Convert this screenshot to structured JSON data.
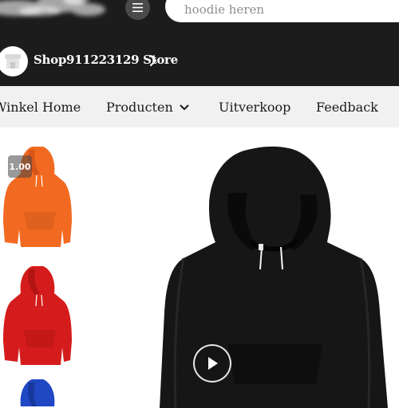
{
  "header": {
    "menu_icon": "hamburger-menu-icon",
    "search": {
      "placeholder": "hoodie heren",
      "value": ""
    }
  },
  "store": {
    "name": "Shop911223129 Store",
    "avatar_icon": "storefront-icon",
    "chevron_icon": "chevron-right-icon"
  },
  "nav": {
    "items": [
      {
        "label": "Winkel Home"
      },
      {
        "label": "Producten",
        "icon": "chevron-down-icon"
      },
      {
        "label": "Uitverkoop"
      },
      {
        "label": "Feedback"
      }
    ]
  },
  "gallery": {
    "badge": "1.00",
    "thumbnails": [
      {
        "color": "#f26a21",
        "name": "orange hoodie"
      },
      {
        "color": "#d51c1c",
        "name": "red hoodie"
      },
      {
        "color": "#2047c4",
        "name": "blue hoodie"
      }
    ],
    "main": {
      "color": "#161616",
      "play_icon": "play-icon"
    }
  }
}
